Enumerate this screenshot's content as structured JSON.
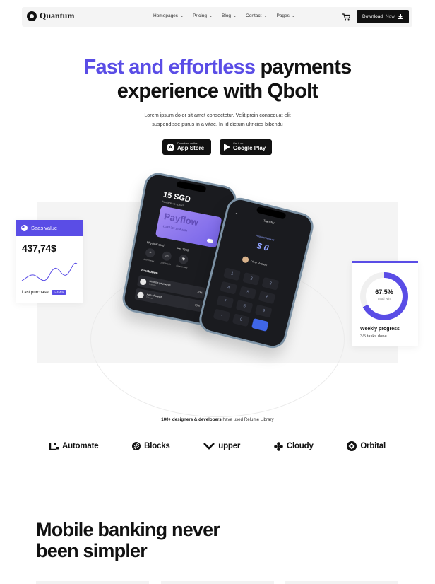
{
  "nav": {
    "brand": "Quantum",
    "menu": [
      "Homepages",
      "Pricing",
      "Blog",
      "Contact",
      "Pages"
    ],
    "download_label": "Download",
    "download_suffix": "Now"
  },
  "hero": {
    "title_accent": "Fast and effortless",
    "title_rest_1": "payments",
    "title_line_2": "experience with Qbolt",
    "subtitle": "Lorem ipsum dolor sit amet consectetur. Velit proin consequat elit suspendisse purus in a vitae. In id dictum ultricies bibendu",
    "app_store": {
      "small": "Download on the",
      "big": "App Store"
    },
    "google_play": {
      "small": "Get it on",
      "big": "Google Play"
    }
  },
  "phone_left": {
    "amount": "15 SGD",
    "available": "Available to spend",
    "card_name": "Payflow",
    "card_number": "1234  1234  1234  1234",
    "physical_card": "Physical card",
    "card_dots": "•••• 7868",
    "actions": [
      "Add money",
      "Card details",
      "Freeze card"
    ],
    "breakdown_title": "Breakdown",
    "rows": [
      {
        "title": "Un time payments",
        "sub": "7 month",
        "pct": "70%"
      },
      {
        "title": "Age of credit",
        "sub": "7 month",
        "pct": "75%"
      }
    ]
  },
  "phone_right": {
    "title": "Transfer",
    "request_label": "Request Amount",
    "amount": "$ 0",
    "user": "Oliver Matthew",
    "keys": [
      "1",
      "2",
      "3",
      "4",
      "5",
      "6",
      "7",
      "8",
      "9",
      ".",
      "0",
      "→"
    ]
  },
  "saas_card": {
    "title": "Saas value",
    "value": "437,74$",
    "footer_label": "Last purchase",
    "footer_pill": "144.4 %"
  },
  "progress_card": {
    "percent_value": 67.5,
    "percent_label": "67.5%",
    "sub_label": "Lead Win",
    "title": "Weekly progress",
    "subtitle": "3/5 tasks done"
  },
  "social_proof": {
    "bold": "100+ designers & developers",
    "rest": "have used Relume Library"
  },
  "logos": [
    "Automate",
    "Blocks",
    "upper",
    "Cloudy",
    "Orbital"
  ],
  "section": {
    "title_line_1": "Mobile banking never",
    "title_line_2": "been simpler"
  },
  "colors": {
    "accent": "#5a4de6",
    "dark": "#111111",
    "panel": "#f4f4f4"
  }
}
